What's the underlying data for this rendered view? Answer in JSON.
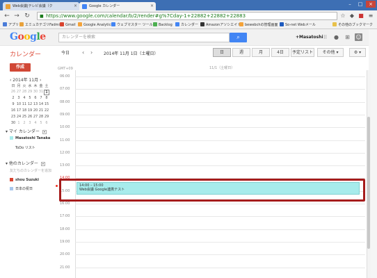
{
  "browser": {
    "tabs": [
      {
        "label": "Web会議|テレビ会議（ク"
      },
      {
        "label": "Google カレンダー"
      }
    ],
    "url": "https://www.google.com/calendar/b/2/render#g%7Cday-1+22882+22882+22883",
    "bookmarks": [
      {
        "label": "アプリ",
        "color": "#4a7cd8"
      },
      {
        "label": "エミュカテゴリFadmin",
        "color": "#e8a23c"
      },
      {
        "label": "Gmail",
        "color": "#d9442f"
      },
      {
        "label": "Google Analytics",
        "color": "#f4a33a"
      },
      {
        "label": "ウェブマスター ツール",
        "color": "#4285f4"
      },
      {
        "label": "Backlog",
        "color": "#4caf50"
      },
      {
        "label": "カレンダー",
        "color": "#4285f4"
      },
      {
        "label": "Amazonアソシエイト",
        "color": "#333333"
      },
      {
        "label": "bewebchの管理画面",
        "color": "#f4a33a"
      },
      {
        "label": "So-net Webメール",
        "color": "#1e5bbf"
      }
    ],
    "other_bookmarks": "その他のブックマーク"
  },
  "header": {
    "logo": "Google",
    "search_placeholder": "カレンダーを検索",
    "username": "+Masatoshi"
  },
  "toolbar": {
    "app_title": "カレンダー",
    "today": "今日",
    "date_label": "2014年 11月 1日（土曜日）",
    "views": [
      "日",
      "週",
      "月",
      "4日",
      "予定リスト"
    ],
    "selected_view": "日",
    "more": "その他 ▾"
  },
  "sidebar": {
    "create": "作成",
    "mini_month": "‹ 2014年 11月 ›",
    "weekdays": [
      "日",
      "月",
      "火",
      "水",
      "木",
      "金",
      "土"
    ],
    "weeks": [
      [
        "26",
        "27",
        "28",
        "29",
        "30",
        "31",
        "1"
      ],
      [
        "2",
        "3",
        "4",
        "5",
        "6",
        "7",
        "8"
      ],
      [
        "9",
        "10",
        "11",
        "12",
        "13",
        "14",
        "15"
      ],
      [
        "16",
        "17",
        "18",
        "19",
        "20",
        "21",
        "22"
      ],
      [
        "23",
        "24",
        "25",
        "26",
        "27",
        "28",
        "29"
      ],
      [
        "30",
        "1",
        "2",
        "3",
        "4",
        "5",
        "6"
      ]
    ],
    "my_calendars_title": "マイ カレンダー",
    "my_calendars": [
      {
        "label": "Masatoshi Tanaka",
        "color": "#a7ecec"
      },
      {
        "label": "ToDo リスト",
        "color": ""
      }
    ],
    "other_calendars_title": "他のカレンダー",
    "add_friend": "友だちのカレンダーを追加",
    "other_calendars": [
      {
        "label": "shou Suzuki",
        "color": "#d9442f"
      },
      {
        "label": "日本の祝日",
        "color": "#a8c7ec"
      }
    ]
  },
  "main": {
    "all_day": "GMT+09",
    "day_header": "11/1（土曜日）",
    "hours": [
      "06:00",
      "07:00",
      "08:00",
      "09:00",
      "10:00",
      "11:00",
      "12:00",
      "13:00",
      "14:00",
      "15:00",
      "16:00",
      "17:00",
      "18:00",
      "19:00",
      "20:00",
      "21:00"
    ],
    "event": {
      "time": "14:00 – 15:00",
      "title": "Web会議 Google連携テスト"
    }
  }
}
